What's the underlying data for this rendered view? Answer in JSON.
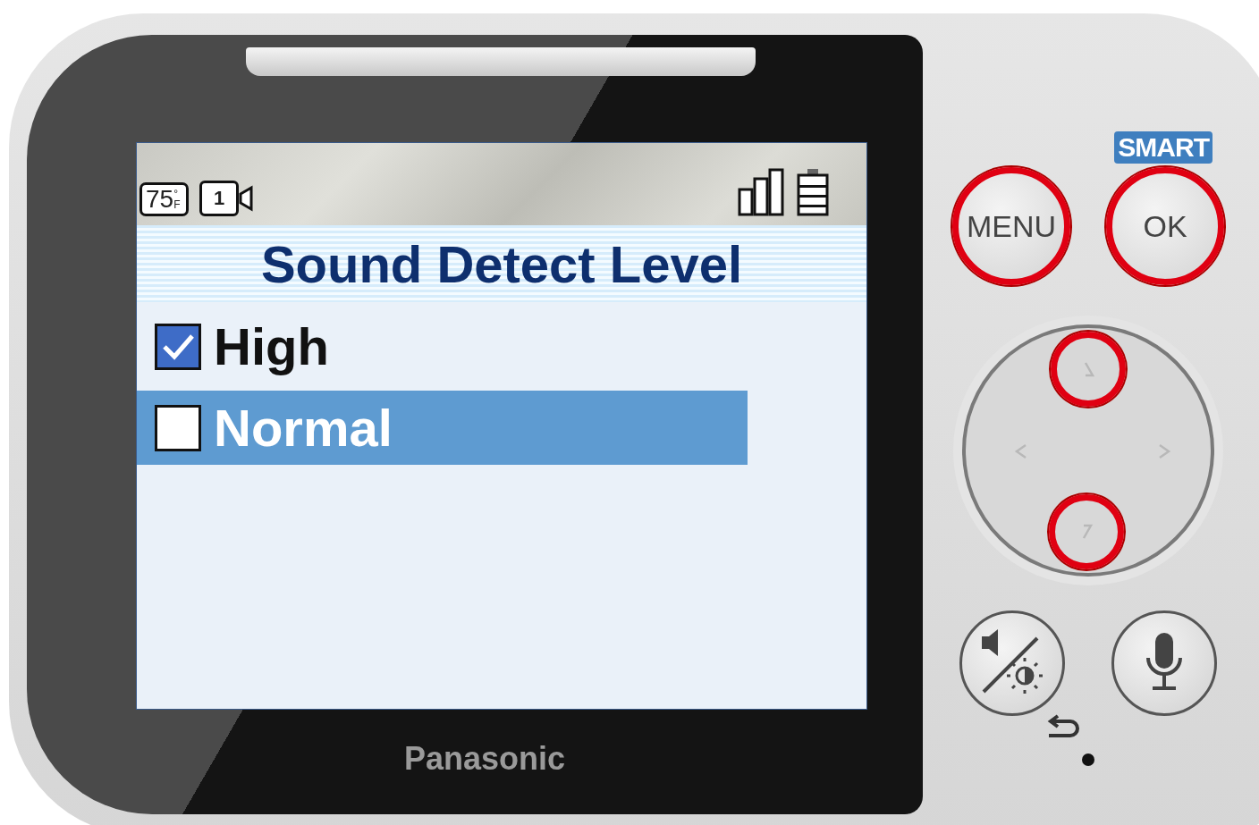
{
  "status_bar": {
    "temperature": "75",
    "temperature_unit": "°F",
    "camera_number": "1"
  },
  "title": "Sound Detect Level",
  "options": [
    {
      "label": "High",
      "checked": true,
      "selected": false
    },
    {
      "label": "Normal",
      "checked": false,
      "selected": true
    }
  ],
  "brand": "Panasonic",
  "controls": {
    "smart_label": "SMART",
    "buttons": [
      {
        "label": "MENU",
        "highlighted": true
      },
      {
        "label": "OK",
        "highlighted": true
      }
    ],
    "dpad": [
      {
        "kind": "up",
        "highlighted": true
      },
      {
        "kind": "left",
        "highlighted": false
      },
      {
        "kind": "right",
        "highlighted": false
      },
      {
        "kind": "down",
        "highlighted": true
      }
    ],
    "round_buttons": [
      {
        "kind": "speaker-brightness",
        "highlighted": false
      },
      {
        "kind": "microphone",
        "highlighted": false
      }
    ]
  }
}
